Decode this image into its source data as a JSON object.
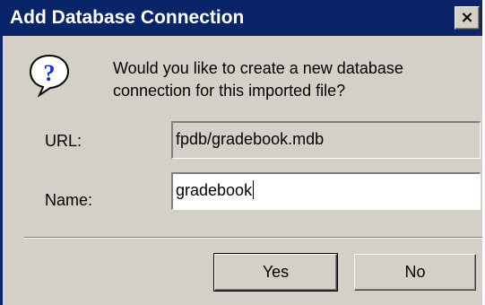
{
  "dialog": {
    "title": "Add Database Connection",
    "close_label": "×",
    "icon": "question-icon",
    "message": "Would you like to create a new database connection for this imported file?"
  },
  "form": {
    "url_label": "URL:",
    "url_value": "fpdb/gradebook.mdb",
    "name_label": "Name:",
    "name_value": "gradebook"
  },
  "buttons": {
    "yes_label": "Yes",
    "no_label": "No"
  },
  "colors": {
    "titlebar": "#0a246a",
    "face": "#d4d0c8",
    "icon_blue": "#1a2fd0"
  }
}
